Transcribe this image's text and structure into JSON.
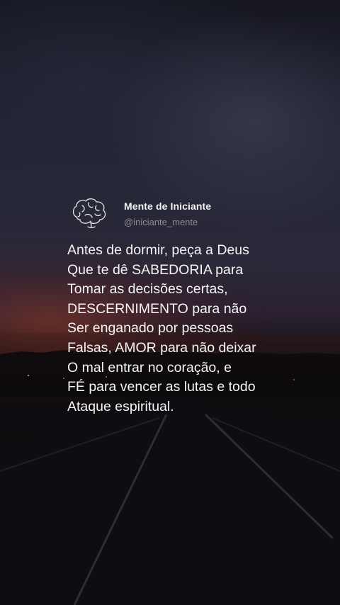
{
  "post": {
    "author_name": "Mente de Iniciante",
    "author_handle": "@iniciante_mente",
    "avatar_icon": "brain-icon",
    "text_lines": [
      "Antes de dormir, peça a Deus",
      "Que te dê SABEDORIA para",
      "Tomar as decisões certas,",
      "DESCERNIMENTO para não",
      "Ser enganado por pessoas",
      "Falsas, AMOR para não deixar",
      "O mal entrar no coração, e",
      "FÉ para vencer as lutas e todo",
      "Ataque espiritual."
    ]
  },
  "colors": {
    "text": "#f4f4f4",
    "handle": "#8d8c93",
    "sunset": "#963c28"
  }
}
